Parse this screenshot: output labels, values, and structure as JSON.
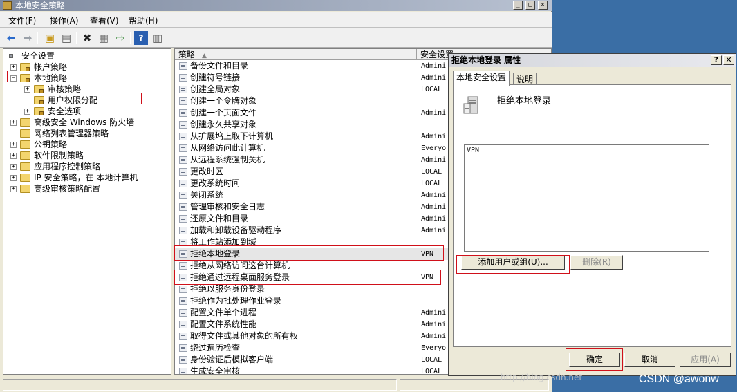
{
  "window": {
    "title": "本地安全策略"
  },
  "menu": [
    "文件(F)",
    "操作(A)",
    "查看(V)",
    "帮助(H)"
  ],
  "toolbar": [
    "back-icon",
    "forward-icon",
    "up-folder-icon",
    "show-hide-tree-icon",
    "delete-icon",
    "properties-icon",
    "export-icon",
    "help-icon",
    "console-icon"
  ],
  "tree": {
    "root": "安全设置",
    "items": [
      {
        "label": "帐户策略",
        "level": 1,
        "expand": "+"
      },
      {
        "label": "本地策略",
        "level": 1,
        "expand": "−"
      },
      {
        "label": "审核策略",
        "level": 2,
        "expand": "+"
      },
      {
        "label": "用户权限分配",
        "level": 2,
        "expand": ""
      },
      {
        "label": "安全选项",
        "level": 2,
        "expand": "+"
      },
      {
        "label": "高级安全 Windows 防火墙",
        "level": 1,
        "expand": "+"
      },
      {
        "label": "网络列表管理器策略",
        "level": 1,
        "expand": ""
      },
      {
        "label": "公钥策略",
        "level": 1,
        "expand": "+"
      },
      {
        "label": "软件限制策略",
        "level": 1,
        "expand": "+"
      },
      {
        "label": "应用程序控制策略",
        "level": 1,
        "expand": "+"
      },
      {
        "label": "IP 安全策略，在 本地计算机",
        "level": 1,
        "expand": "+"
      },
      {
        "label": "高级审核策略配置",
        "level": 1,
        "expand": "+"
      }
    ]
  },
  "list": {
    "col_policy": "策略",
    "col_setting": "安全设置",
    "rows": [
      {
        "name": "备份文件和目录",
        "value": "Admini"
      },
      {
        "name": "创建符号链接",
        "value": "Admini"
      },
      {
        "name": "创建全局对象",
        "value": "LOCAL"
      },
      {
        "name": "创建一个令牌对象",
        "value": ""
      },
      {
        "name": "创建一个页面文件",
        "value": "Admini"
      },
      {
        "name": "创建永久共享对象",
        "value": ""
      },
      {
        "name": "从扩展坞上取下计算机",
        "value": "Admini"
      },
      {
        "name": "从网络访问此计算机",
        "value": "Everyo"
      },
      {
        "name": "从远程系统强制关机",
        "value": "Admini"
      },
      {
        "name": "更改时区",
        "value": "LOCAL"
      },
      {
        "name": "更改系统时间",
        "value": "LOCAL"
      },
      {
        "name": "关闭系统",
        "value": "Admini"
      },
      {
        "name": "管理审核和安全日志",
        "value": "Admini"
      },
      {
        "name": "还原文件和目录",
        "value": "Admini"
      },
      {
        "name": "加载和卸载设备驱动程序",
        "value": "Admini"
      },
      {
        "name": "将工作站添加到域",
        "value": ""
      },
      {
        "name": "拒绝本地登录",
        "value": "VPN"
      },
      {
        "name": "拒绝从网络访问这台计算机",
        "value": ""
      },
      {
        "name": "拒绝通过远程桌面服务登录",
        "value": "VPN"
      },
      {
        "name": "拒绝以服务身份登录",
        "value": ""
      },
      {
        "name": "拒绝作为批处理作业登录",
        "value": ""
      },
      {
        "name": "配置文件单个进程",
        "value": "Admini"
      },
      {
        "name": "配置文件系统性能",
        "value": "Admini"
      },
      {
        "name": "取得文件或其他对象的所有权",
        "value": "Admini"
      },
      {
        "name": "绕过遍历检查",
        "value": "Everyo"
      },
      {
        "name": "身份验证后模拟客户端",
        "value": "LOCAL"
      },
      {
        "name": "生成安全审核",
        "value": "LOCAL"
      }
    ]
  },
  "dialog": {
    "title": "拒绝本地登录 属性",
    "help": "?",
    "close": "✕",
    "tab_local": "本地安全设置",
    "tab_explain": "说明",
    "policy_name": "拒绝本地登录",
    "members": [
      "VPN"
    ],
    "add_button": "添加用户或组(U)...",
    "remove_button": "删除(R)",
    "ok": "确定",
    "cancel": "取消",
    "apply": "应用(A)"
  },
  "watermark": "http://blog.csdn.net",
  "csdn_label": "CSDN @awonw"
}
